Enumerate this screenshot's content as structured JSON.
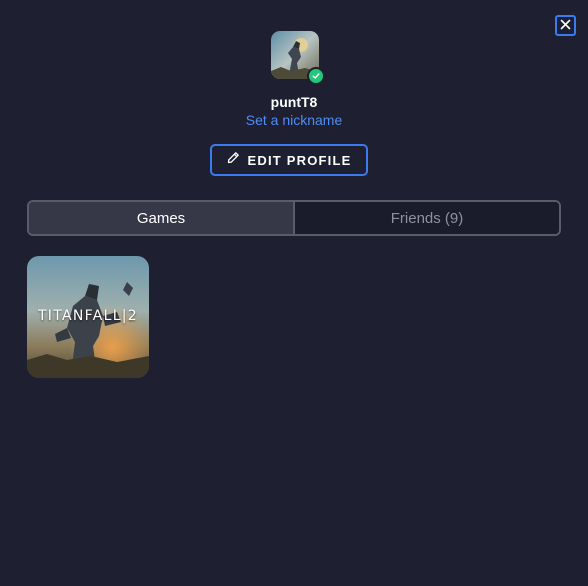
{
  "window": {
    "close_icon": "close-icon"
  },
  "profile": {
    "username": "puntT8",
    "nickname_link": "Set a nickname",
    "status": "online",
    "status_color": "#22c77a"
  },
  "edit_profile": {
    "label": "EDIT PROFILE",
    "icon": "pencil-icon"
  },
  "tabs": [
    {
      "label": "Games",
      "active": true
    },
    {
      "label": "Friends (9)",
      "active": false
    }
  ],
  "games": [
    {
      "title": "TITANFALL|2"
    }
  ],
  "colors": {
    "background": "#1e1f30",
    "accent": "#3b7bf1",
    "link": "#4f8cf7",
    "tab_active_bg": "#363848",
    "tab_border": "#5a5c6c"
  }
}
